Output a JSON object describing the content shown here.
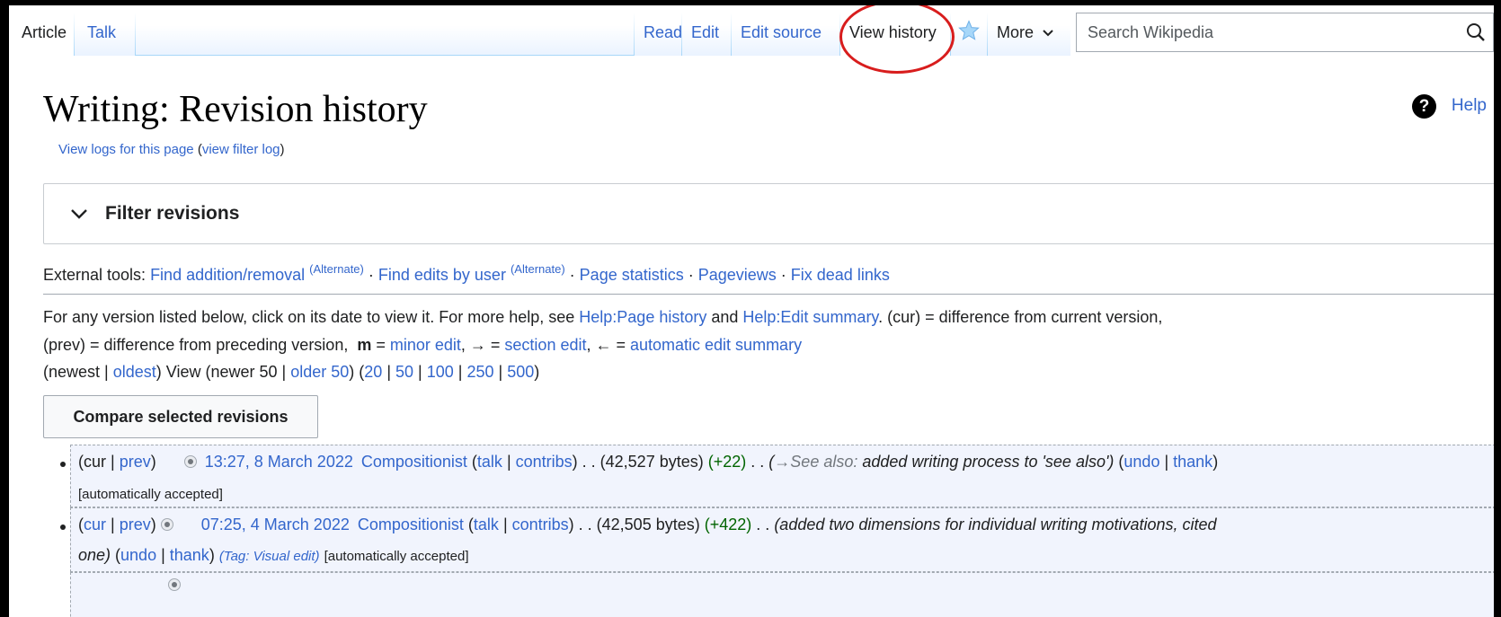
{
  "tabs": {
    "left": [
      "Article",
      "Talk"
    ],
    "right": [
      "Read",
      "Edit",
      "Edit source",
      "View history"
    ],
    "more": "More",
    "selected": "View history"
  },
  "search": {
    "placeholder": "Search Wikipedia"
  },
  "page": {
    "title": "Writing: Revision history",
    "help": "Help",
    "logs_text": "View logs for this page",
    "logs_paren_open": " (",
    "filter_log": "view filter log",
    "logs_paren_close": ")"
  },
  "filter": {
    "label": "Filter revisions"
  },
  "external_tools": {
    "prefix": "External tools: ",
    "find_addition": "Find addition/removal",
    "alternate1": "(Alternate)",
    "find_edits": "Find edits by user",
    "alternate2": "(Alternate)",
    "page_stats": "Page statistics",
    "pageviews": "Pageviews",
    "fix_dead": "Fix dead links",
    "sep": " · "
  },
  "legend": {
    "l1_a": "For any version listed below, click on its date to view it. For more help, see ",
    "l1_help_history": "Help:Page history",
    "l1_and": " and ",
    "l1_help_summary": "Help:Edit summary",
    "l1_b": ". (cur) = difference from current version,",
    "l2_a": "(prev) = difference from preceding version,  ",
    "l2_m": "m",
    "l2_eq": " = ",
    "l2_minor": "minor edit",
    "l2_arrow": ", → = ",
    "l2_section": "section edit",
    "l2_back": ", ← = ",
    "l2_auto": "automatic edit summary"
  },
  "nav": {
    "newest": "newest",
    "oldest": "oldest",
    "view": "View",
    "newer": "newer 50",
    "older": "older 50",
    "limits": [
      "20",
      "50",
      "100",
      "250",
      "500"
    ]
  },
  "compare_button": "Compare selected revisions",
  "revisions": [
    {
      "cur": "cur",
      "prev": "prev",
      "date": "13:27, 8 March 2022",
      "user": "Compositionist",
      "talk": "talk",
      "contribs": "contribs",
      "bytes": "(42,527 bytes)",
      "delta": "(+22)",
      "arrow_section": "→See also:",
      "summary": "added writing process to 'see also')",
      "undo": "undo",
      "thank": "thank",
      "accepted": "[automatically accepted]"
    },
    {
      "cur": "cur",
      "prev": "prev",
      "date": "07:25, 4 March 2022",
      "user": "Compositionist",
      "talk": "talk",
      "contribs": "contribs",
      "bytes": "(42,505 bytes)",
      "delta": "(+422)",
      "summary_l1": "(added two dimensions for individual writing motivations, cited",
      "summary_l2": "one)",
      "undo": "undo",
      "thank": "thank",
      "tag": "(Tag: Visual edit)",
      "accepted": "[automatically accepted]"
    }
  ],
  "colors": {
    "link": "#3366cc",
    "positive": "#006400",
    "highlight_circle": "#d81d1d"
  }
}
